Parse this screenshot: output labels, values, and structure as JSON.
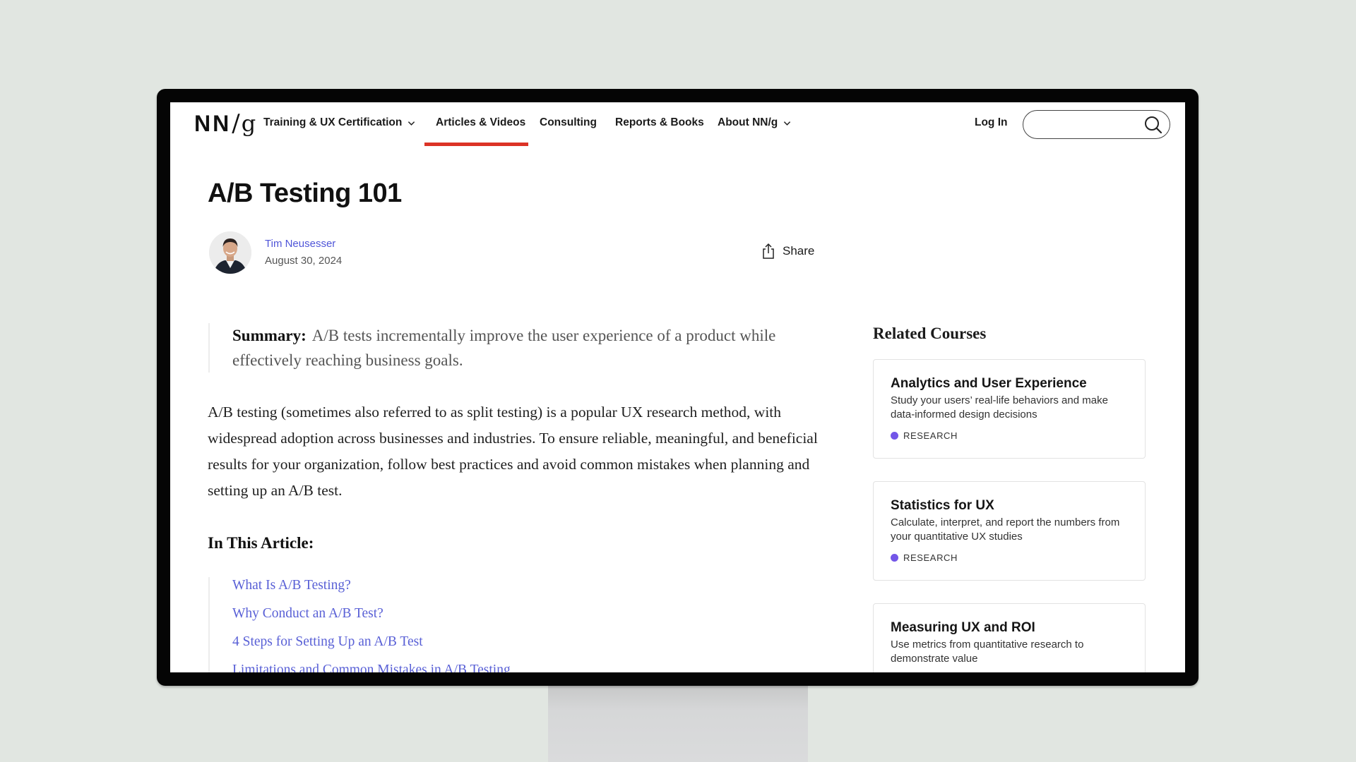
{
  "nav": {
    "logo": {
      "nn": "NN",
      "slash": "/",
      "g": "g"
    },
    "items": [
      {
        "label": "Training & UX Certification",
        "has_dropdown": true
      },
      {
        "label": "Articles & Videos",
        "active": true
      },
      {
        "label": "Consulting"
      },
      {
        "label": "Reports & Books"
      },
      {
        "label": "About NN/g",
        "has_dropdown": true
      }
    ],
    "login_label": "Log In",
    "search": {
      "value": "",
      "placeholder": ""
    },
    "active_color": "#dc3326"
  },
  "article": {
    "title": "A/B Testing 101",
    "author": "Tim Neusesser",
    "date": "August 30, 2024",
    "share_label": "Share",
    "summary_label": "Summary:",
    "summary_text": "A/B tests incrementally improve the user experience of a product while effectively reaching business goals.",
    "body": "A/B testing (sometimes also referred to as split testing) is a popular UX research method, with widespread adoption across businesses and industries. To ensure reliable, meaningful, and beneficial results for your organization, follow best practices and avoid common mistakes when planning and setting up an A/B test.",
    "toc_heading": "In This Article:",
    "toc": [
      "What Is A/B Testing?",
      "Why Conduct an A/B Test?",
      "4 Steps for Setting Up an A/B Test",
      "Limitations and Common Mistakes in A/B Testing"
    ],
    "link_color": "#5960d6"
  },
  "sidebar": {
    "heading": "Related Courses",
    "courses": [
      {
        "title": "Analytics and User Experience",
        "description": "Study your users’ real-life behaviors and make data-informed design decisions",
        "tag": "RESEARCH",
        "tag_color": "#7356e8"
      },
      {
        "title": "Statistics for UX",
        "description": "Calculate, interpret, and report the numbers from your quantitative UX studies",
        "tag": "RESEARCH",
        "tag_color": "#7356e8"
      },
      {
        "title": "Measuring UX and ROI",
        "description": "Use metrics from quantitative research to demonstrate value",
        "tag": "",
        "tag_color": "#7356e8"
      }
    ]
  }
}
